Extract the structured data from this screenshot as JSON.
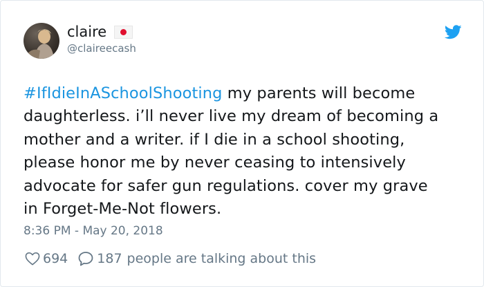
{
  "author": {
    "name": "claire",
    "handle": "@claireecash"
  },
  "tweet": {
    "hashtag": "#IfIdieInASchoolShooting",
    "lines": [
      " my parents will become",
      "daughterless. i’ll never live my dream of becoming a",
      "mother and a writer. if I die in a school shooting,",
      "please honor me by never ceasing to intensively",
      "advocate for safer gun regulations. cover my grave",
      "in Forget-Me-Not flowers."
    ],
    "timestamp": "8:36 PM - May 20, 2018"
  },
  "engagement": {
    "likes": "694",
    "talking_count": "187",
    "talking_text": "people are talking about this"
  },
  "icons": {
    "brand": "twitter-bird-icon",
    "flag": "japan-flag-icon",
    "like": "heart-icon",
    "reply": "speech-bubble-icon"
  },
  "colors": {
    "brand_blue": "#1da1f2",
    "hashtag_blue": "#1b95e0",
    "muted_gray": "#657786",
    "text_dark": "#14171a",
    "flag_red": "#e0102f"
  }
}
